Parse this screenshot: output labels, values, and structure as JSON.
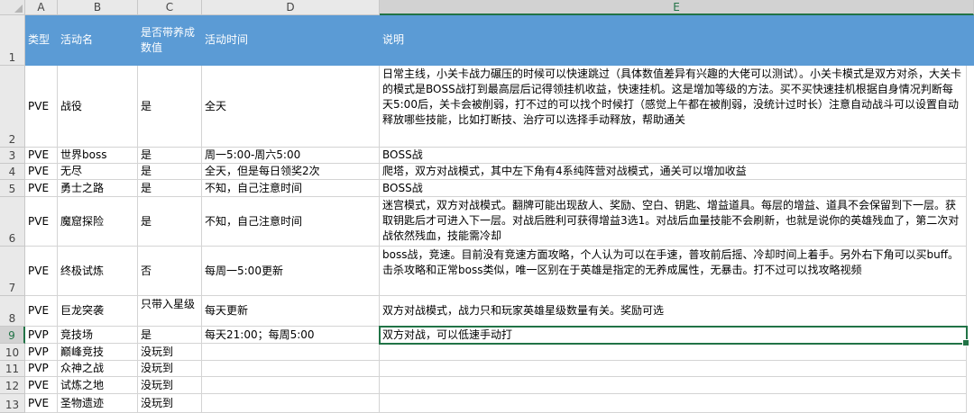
{
  "columns": [
    "A",
    "B",
    "C",
    "D",
    "E"
  ],
  "rows": [
    "1",
    "2",
    "3",
    "4",
    "5",
    "6",
    "7",
    "8",
    "9",
    "10",
    "11",
    "12",
    "13"
  ],
  "header": {
    "type": "类型",
    "name": "活动名",
    "growth": "是否带养成数值",
    "time": "活动时间",
    "desc": "说明"
  },
  "data": [
    {
      "type": "PVE",
      "name": "战役",
      "growth": "是",
      "time": "全天",
      "desc": "日常主线，小关卡战力碾压的时候可以快速跳过（具体数值差异有兴趣的大佬可以测试）。小关卡模式是双方对杀，大关卡的模式是BOSS战打到最高层后记得领挂机收益，快速挂机。这是增加等级的方法。买不买快速挂机根据自身情况判断每天5:00后，关卡会被削弱，打不过的可以找个时候打（感觉上午都在被削弱，没统计过时长）注意自动战斗可以设置自动释放哪些技能，比如打断技、治疗可以选择手动释放，帮助通关"
    },
    {
      "type": "PVE",
      "name": "世界boss",
      "growth": "是",
      "time": "周一5:00-周六5:00",
      "desc": "BOSS战"
    },
    {
      "type": "PVE",
      "name": "无尽",
      "growth": "是",
      "time": "全天，但是每日领奖2次",
      "desc": "爬塔，双方对战模式，其中左下角有4系纯阵营对战模式，通关可以增加收益"
    },
    {
      "type": "PVE",
      "name": "勇士之路",
      "growth": "是",
      "time": "不知，自己注意时间",
      "desc": "BOSS战"
    },
    {
      "type": "PVE",
      "name": "魔窟探险",
      "growth": "是",
      "time": "不知，自己注意时间",
      "desc": "迷宫模式，双方对战模式。翻牌可能出现敌人、奖励、空白、钥匙、增益道具。每层的增益、道具不会保留到下一层。获取钥匙后才可进入下一层。对战后胜利可获得增益3选1。对战后血量技能不会刷新，也就是说你的英雄残血了，第二次对战依然残血，技能需冷却"
    },
    {
      "type": "PVE",
      "name": "终极试炼",
      "growth": "否",
      "time": "每周一5:00更新",
      "desc": "boss战，竞速。目前没有竞速方面攻略，个人认为可以在手速，普攻前后摇、冷却时间上着手。另外右下角可以买buff。击杀攻略和正常boss类似，唯一区别在于英雄是指定的无养成属性，无暴击。打不过可以找攻略视频"
    },
    {
      "type": "PVE",
      "name": "巨龙突袭",
      "growth": "只带入星级",
      "time": "每天更新",
      "desc": "双方对战模式，战力只和玩家英雄星级数量有关。奖励可选"
    },
    {
      "type": "PVP",
      "name": "竞技场",
      "growth": "是",
      "time": "每天21:00；每周5:00",
      "desc": "双方对战，可以低速手动打"
    },
    {
      "type": "PVP",
      "name": "巅峰竞技",
      "growth": "没玩到",
      "time": "",
      "desc": ""
    },
    {
      "type": "PVP",
      "name": "众神之战",
      "growth": "没玩到",
      "time": "",
      "desc": ""
    },
    {
      "type": "PVE",
      "name": "试炼之地",
      "growth": "没玩到",
      "time": "",
      "desc": ""
    },
    {
      "type": "PVE",
      "name": "圣物遗迹",
      "growth": "没玩到",
      "time": "",
      "desc": ""
    }
  ],
  "colors": {
    "header_fill": "#5b9bd5",
    "selection": "#217346"
  }
}
